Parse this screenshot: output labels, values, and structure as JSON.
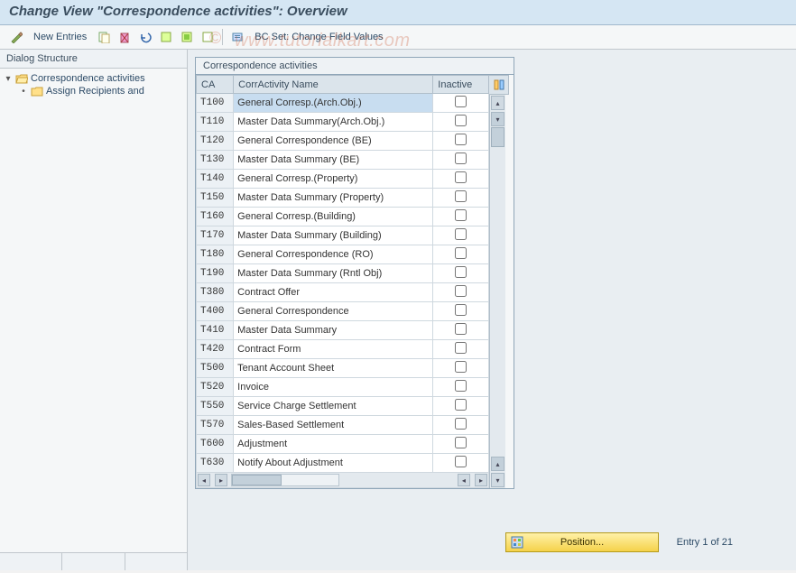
{
  "header": {
    "title": "Change View \"Correspondence activities\": Overview"
  },
  "toolbar": {
    "new_entries": "New Entries",
    "bc_set": "BC Set: Change Field Values"
  },
  "dialog_structure": {
    "title": "Dialog Structure",
    "items": [
      {
        "label": "Correspondence activities",
        "level": 0,
        "expanded": true,
        "open": true
      },
      {
        "label": "Assign Recipients and",
        "level": 1,
        "expanded": false,
        "open": false
      }
    ]
  },
  "grid": {
    "title": "Correspondence activities",
    "columns": {
      "ca": "CA",
      "name": "CorrActivity Name",
      "inactive": "Inactive"
    },
    "rows": [
      {
        "ca": "T100",
        "name": "General Corresp.(Arch.Obj.)",
        "inactive": false,
        "selected": true
      },
      {
        "ca": "T110",
        "name": "Master Data Summary(Arch.Obj.)",
        "inactive": false
      },
      {
        "ca": "T120",
        "name": "General Correspondence (BE)",
        "inactive": false
      },
      {
        "ca": "T130",
        "name": "Master Data Summary (BE)",
        "inactive": false
      },
      {
        "ca": "T140",
        "name": "General Corresp.(Property)",
        "inactive": false
      },
      {
        "ca": "T150",
        "name": "Master Data Summary (Property)",
        "inactive": false
      },
      {
        "ca": "T160",
        "name": "General Corresp.(Building)",
        "inactive": false
      },
      {
        "ca": "T170",
        "name": "Master Data Summary (Building)",
        "inactive": false
      },
      {
        "ca": "T180",
        "name": "General Correspondence (RO)",
        "inactive": false
      },
      {
        "ca": "T190",
        "name": "Master Data Summary (Rntl Obj)",
        "inactive": false
      },
      {
        "ca": "T380",
        "name": "Contract Offer",
        "inactive": false
      },
      {
        "ca": "T400",
        "name": "General Correspondence",
        "inactive": false
      },
      {
        "ca": "T410",
        "name": "Master Data Summary",
        "inactive": false
      },
      {
        "ca": "T420",
        "name": "Contract Form",
        "inactive": false
      },
      {
        "ca": "T500",
        "name": "Tenant Account Sheet",
        "inactive": false
      },
      {
        "ca": "T520",
        "name": "Invoice",
        "inactive": false
      },
      {
        "ca": "T550",
        "name": "Service Charge Settlement",
        "inactive": false
      },
      {
        "ca": "T570",
        "name": "Sales-Based Settlement",
        "inactive": false
      },
      {
        "ca": "T600",
        "name": "Adjustment",
        "inactive": false
      },
      {
        "ca": "T630",
        "name": "Notify About Adjustment",
        "inactive": false
      }
    ]
  },
  "footer": {
    "position_button": "Position...",
    "entry_text": "Entry 1 of 21"
  },
  "watermark": {
    "copy": "©",
    "text": "www.tutorialkart.com"
  }
}
